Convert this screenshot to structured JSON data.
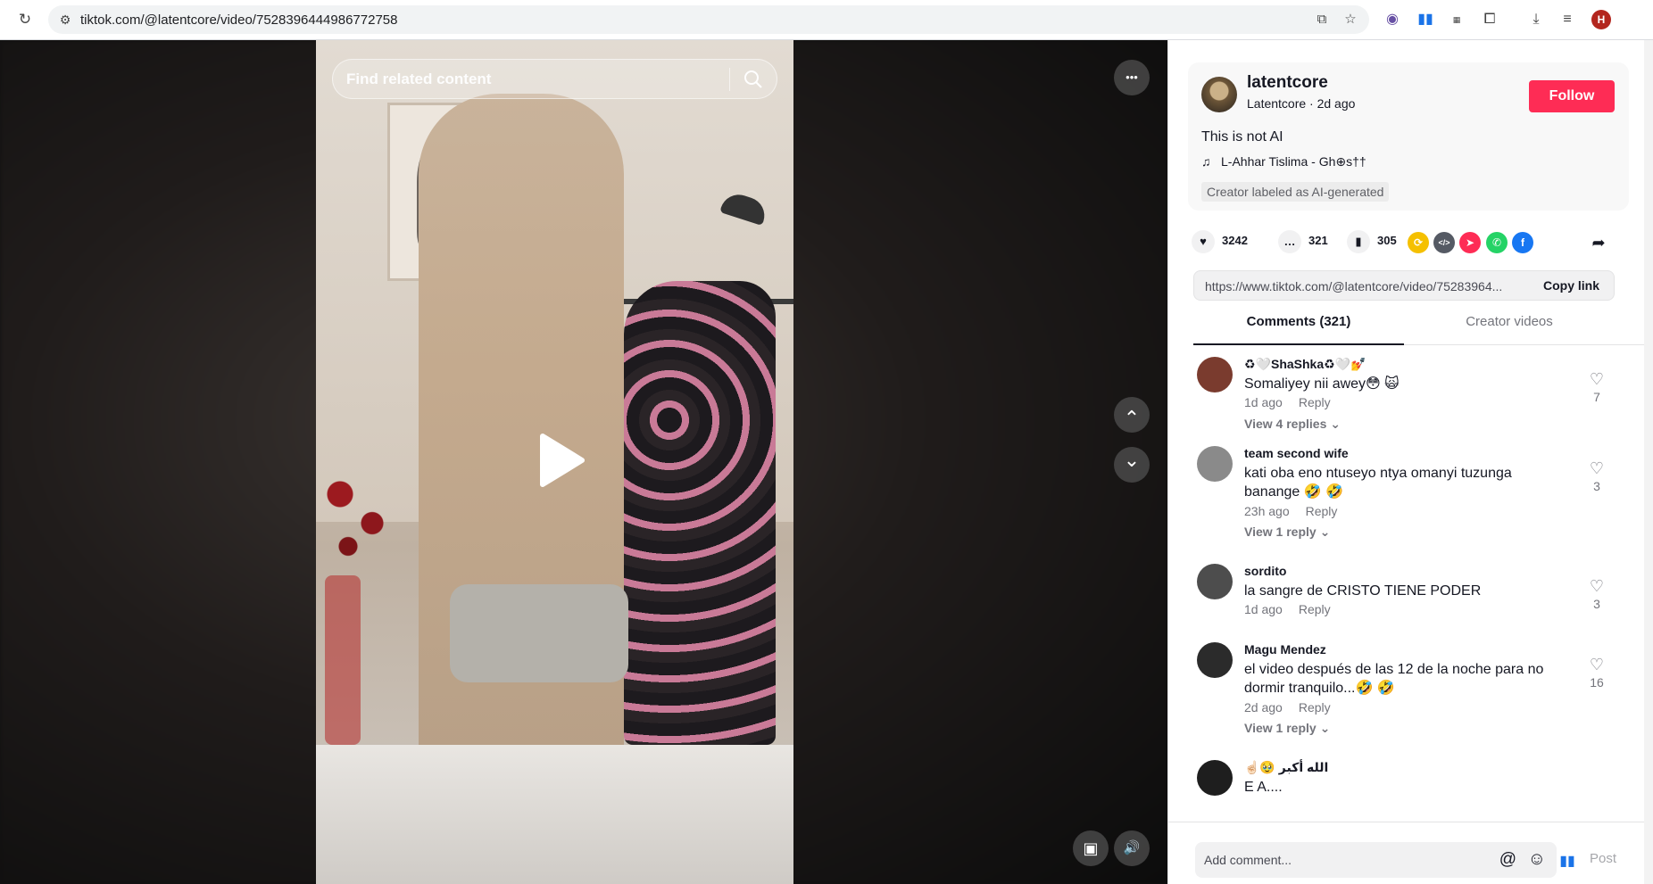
{
  "browser": {
    "url": "tiktok.com/@latentcore/video/7528396444986772758",
    "reload_icon": "↻",
    "site_info_icon": "⚙",
    "profile_initial": "H"
  },
  "video": {
    "search_placeholder": "Find related content",
    "more_icon": "•••",
    "prev_icon": "⌃",
    "next_icon": "⌄",
    "pip_icon": "▣",
    "volume_icon": "🔊"
  },
  "author": {
    "username": "latentcore",
    "nickname_line": "Latentcore · 2d ago",
    "follow_label": "Follow",
    "description": "This is not AI",
    "music": "L-Ahhar Tislima - Gh⊕s††",
    "ai_label": "Creator labeled as AI-generated"
  },
  "stats": {
    "likes": "3242",
    "comments": "321",
    "saves": "305"
  },
  "share": {
    "icons": [
      {
        "name": "repost",
        "color": "#f5c000",
        "glyph": "⟳"
      },
      {
        "name": "embed",
        "color": "#555a64",
        "glyph": "</>"
      },
      {
        "name": "send-to-friends",
        "color": "#fe2c55",
        "glyph": "➤"
      },
      {
        "name": "whatsapp",
        "color": "#25d366",
        "glyph": "✆"
      },
      {
        "name": "facebook",
        "color": "#1877f2",
        "glyph": "f"
      }
    ],
    "more_glyph": "➦"
  },
  "link": {
    "url": "https://www.tiktok.com/@latentcore/video/75283964...",
    "copy_label": "Copy link"
  },
  "tabs": [
    {
      "label": "Comments (321)",
      "active": true
    },
    {
      "label": "Creator videos",
      "active": false
    }
  ],
  "comments": [
    {
      "user": "♻🤍ShaShka♻🤍💅",
      "text": "Somaliyey nii awey😳 🙀",
      "time": "1d ago",
      "reply": "Reply",
      "likes": "7",
      "replies": "View 4 replies ⌄",
      "avatar_color": "#7a3b2e"
    },
    {
      "user": "team second wife",
      "text": "kati oba eno ntuseyo ntya omanyi tuzunga banange 🤣 🤣",
      "time": "23h ago",
      "reply": "Reply",
      "likes": "3",
      "replies": "View 1 reply ⌄",
      "avatar_color": "#8a8a8a"
    },
    {
      "user": "sordito",
      "text": "la sangre de CRISTO TIENE PODER",
      "time": "1d ago",
      "reply": "Reply",
      "likes": "3",
      "replies": "",
      "avatar_color": "#4d4d4d"
    },
    {
      "user": "Magu Mendez",
      "text": "el video después de las 12 de la noche para no dormir tranquilo...🤣 🤣",
      "time": "2d ago",
      "reply": "Reply",
      "likes": "16",
      "replies": "View 1 reply ⌄",
      "avatar_color": "#2b2b2b"
    },
    {
      "user": "☝🏻🥹 الله أكبر",
      "text": "E A....",
      "time": "",
      "reply": "",
      "likes": "",
      "replies": "",
      "avatar_color": "#1e1e1e"
    }
  ],
  "add_comment": {
    "placeholder": "Add comment...",
    "at_icon": "@",
    "emoji_icon": "☺",
    "post_label": "Post"
  }
}
